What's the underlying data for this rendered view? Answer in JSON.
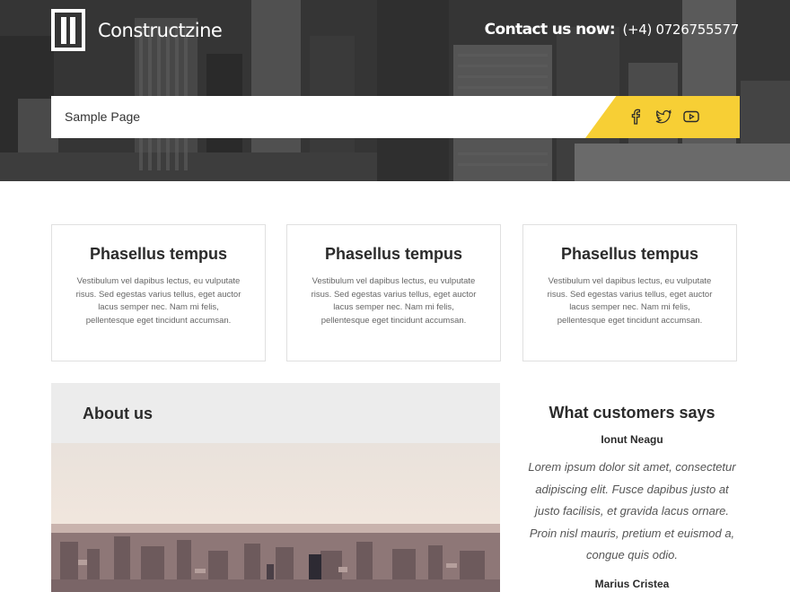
{
  "header": {
    "brand": "Constructzine",
    "contact_label": "Contact us now:",
    "contact_phone": "(+4) 0726755577"
  },
  "nav": {
    "items": [
      {
        "label": "Sample Page"
      }
    ],
    "social": [
      "facebook-icon",
      "twitter-icon",
      "youtube-icon"
    ],
    "accent": "#f7cf35"
  },
  "features": [
    {
      "title": "Phasellus tempus",
      "text": "Vestibulum vel dapibus lectus, eu vulputate risus. Sed egestas varius tellus, eget auctor lacus semper nec. Nam mi felis, pellentesque eget tincidunt accumsan."
    },
    {
      "title": "Phasellus tempus",
      "text": "Vestibulum vel dapibus lectus, eu vulputate risus. Sed egestas varius tellus, eget auctor lacus semper nec. Nam mi felis, pellentesque eget tincidunt accumsan."
    },
    {
      "title": "Phasellus tempus",
      "text": "Vestibulum vel dapibus lectus, eu vulputate risus. Sed egestas varius tellus, eget auctor lacus semper nec. Nam mi felis, pellentesque eget tincidunt accumsan."
    }
  ],
  "about": {
    "title": "About us"
  },
  "testimonials": {
    "title": "What customers says",
    "items": [
      {
        "name": "Ionut Neagu",
        "quote": "Lorem ipsum dolor sit amet, consectetur adipiscing elit. Fusce dapibus justo at justo facilisis, et gravida lacus ornare. Proin nisl mauris, pretium et euismod a, congue quis odio."
      },
      {
        "name": "Marius Cristea"
      }
    ]
  }
}
